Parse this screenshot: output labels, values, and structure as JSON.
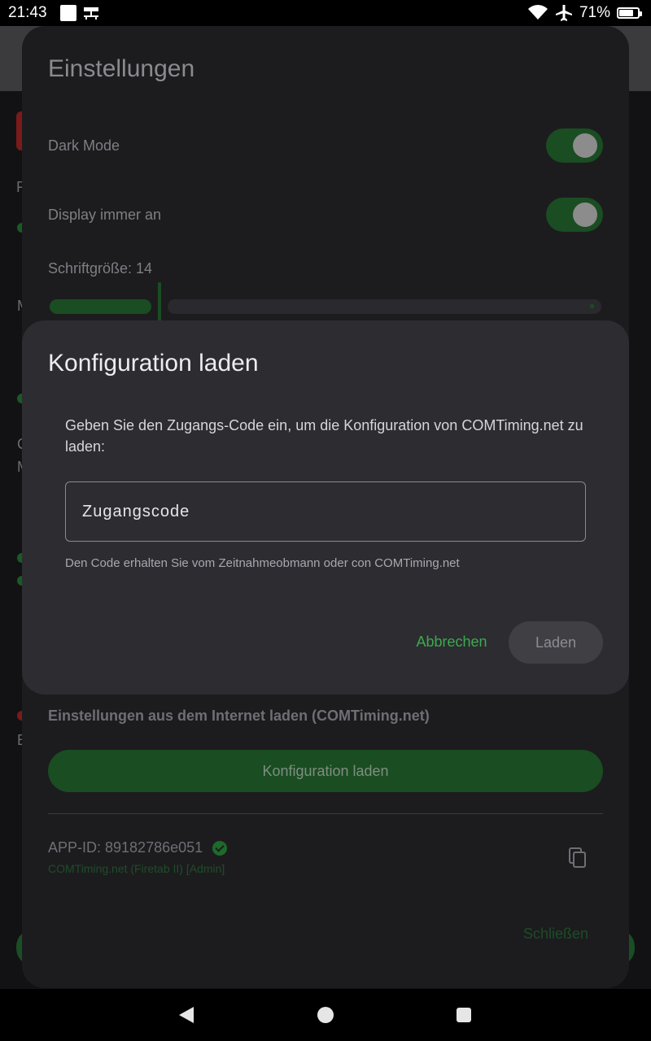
{
  "status_bar": {
    "time": "21:43",
    "battery": "71%",
    "icons": [
      "notification-square-icon",
      "network-icon",
      "wifi-icon",
      "airplane-icon",
      "battery-icon"
    ]
  },
  "settings": {
    "title": "Einstellungen",
    "dark_mode_label": "Dark Mode",
    "display_on_label": "Display immer an",
    "font_size_label": "Schriftgröße: 14",
    "section_label": "Einstellungen aus dem Internet laden (COMTiming.net)",
    "load_config_button": "Konfiguration laden",
    "app_id": "APP-ID: 89182786e051",
    "account_info": "COMTiming.net (Firetab II) [Admin]",
    "close_button": "Schließen"
  },
  "dialog": {
    "title": "Konfiguration laden",
    "description": "Geben Sie den Zugangs-Code ein, um die Konfiguration von COMTiming.net zu laden:",
    "input_placeholder": "Zugangscode",
    "helper_text": "Den Code erhalten Sie vom Zeitnahmeobmann oder con COMTiming.net",
    "cancel_button": "Abbrechen",
    "load_button": "Laden"
  },
  "colors": {
    "accent_green": "#3fa84f",
    "dialog_bg": "#2c2c31",
    "sheet_bg": "#1c1c1f"
  }
}
